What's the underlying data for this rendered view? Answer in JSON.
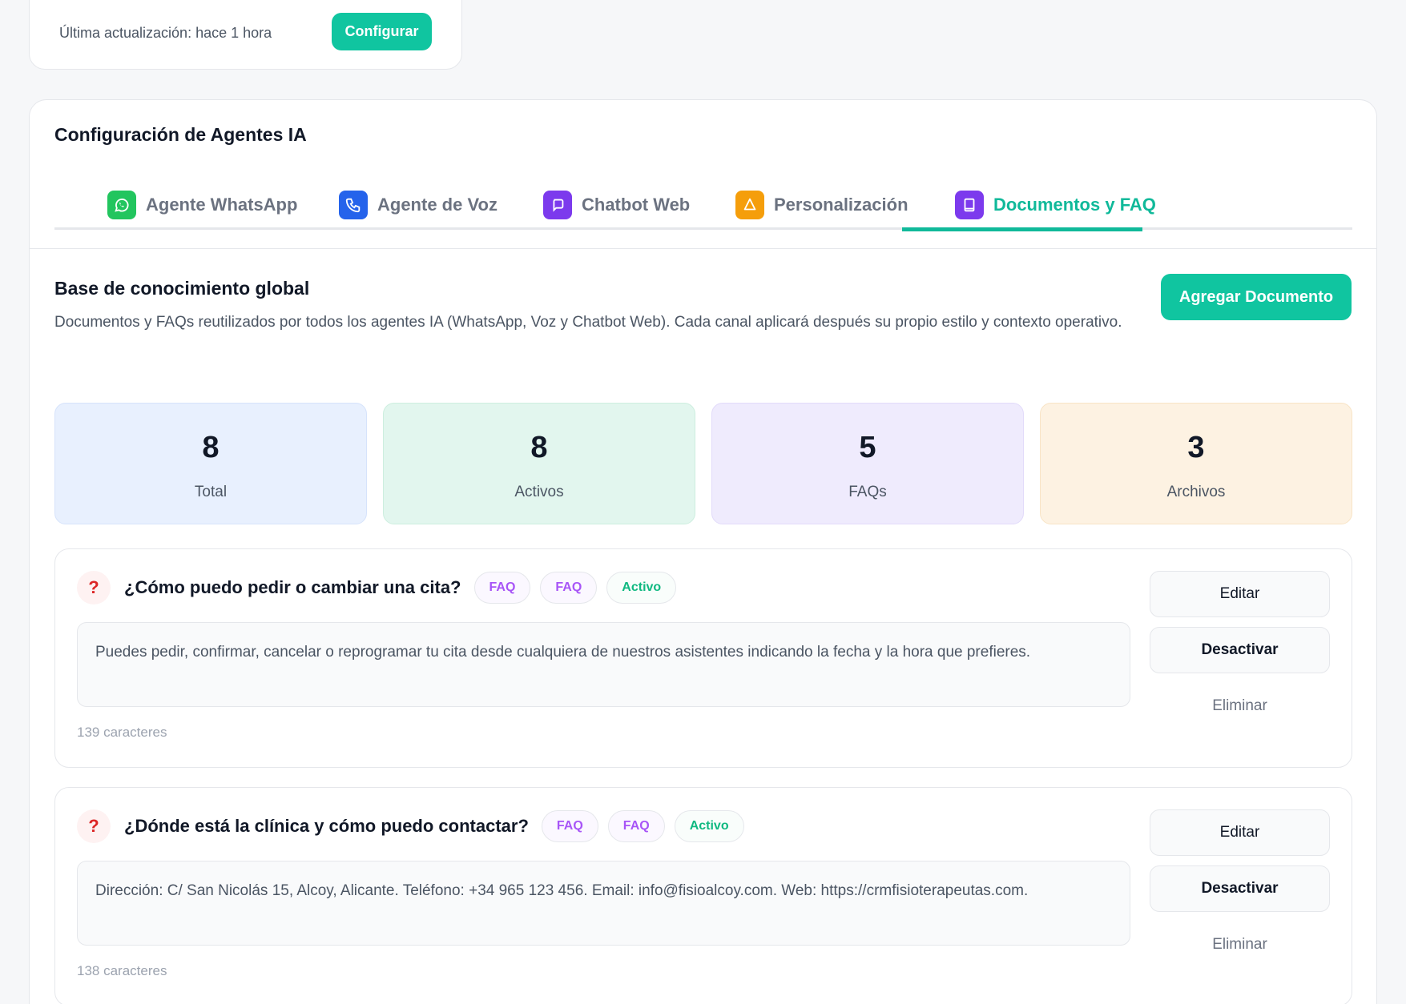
{
  "top_card": {
    "updated_text": "Última actualización: hace 1 hora",
    "configure_label": "Configurar"
  },
  "panel": {
    "title": "Configuración de Agentes IA",
    "tabs": [
      {
        "label": "Agente WhatsApp",
        "icon": "whatsapp-icon",
        "color": "#22c55e"
      },
      {
        "label": "Agente de Voz",
        "icon": "phone-icon",
        "color": "#2563eb"
      },
      {
        "label": "Chatbot Web",
        "icon": "chat-icon",
        "color": "#7c3aed"
      },
      {
        "label": "Personalización",
        "icon": "bell-icon",
        "color": "#f59e0b"
      },
      {
        "label": "Documentos y FAQ",
        "icon": "book-icon",
        "color": "#7c3aed",
        "active": true
      }
    ]
  },
  "knowledge": {
    "title": "Base de conocimiento global",
    "description": "Documentos y FAQs reutilizados por todos los agentes IA (WhatsApp, Voz y Chatbot Web). Cada canal aplicará después su propio estilo y contexto operativo.",
    "add_label": "Agregar Documento"
  },
  "stats": [
    {
      "value": "8",
      "label": "Total",
      "bg": "#e8f0fe"
    },
    {
      "value": "8",
      "label": "Activos",
      "bg": "#e2f6ee"
    },
    {
      "value": "5",
      "label": "FAQs",
      "bg": "#efebfd"
    },
    {
      "value": "3",
      "label": "Archivos",
      "bg": "#fdf2e2"
    }
  ],
  "faqs": [
    {
      "icon": "?",
      "question": "¿Cómo puedo pedir o cambiar una cita?",
      "badges": [
        "FAQ",
        "FAQ",
        "Activo"
      ],
      "answer": "Puedes pedir, confirmar, cancelar o reprogramar tu cita desde cualquiera de nuestros asistentes indicando la fecha y la hora que prefieres.",
      "chars": "139 caracteres",
      "edit_label": "Editar",
      "deactivate_label": "Desactivar",
      "delete_label": "Eliminar"
    },
    {
      "icon": "?",
      "question": "¿Dónde está la clínica y cómo puedo contactar?",
      "badges": [
        "FAQ",
        "FAQ",
        "Activo"
      ],
      "answer": "Dirección: C/ San Nicolás 15, Alcoy, Alicante. Teléfono: +34 965 123 456. Email: info@fisioalcoy.com. Web: https://crmfisioterapeutas.com.",
      "chars": "138 caracteres",
      "edit_label": "Editar",
      "deactivate_label": "Desactivar",
      "delete_label": "Eliminar"
    }
  ],
  "colors": {
    "accent": "#10c5a0",
    "faq_badge": "#a855f7",
    "active_badge": "#10b981"
  }
}
